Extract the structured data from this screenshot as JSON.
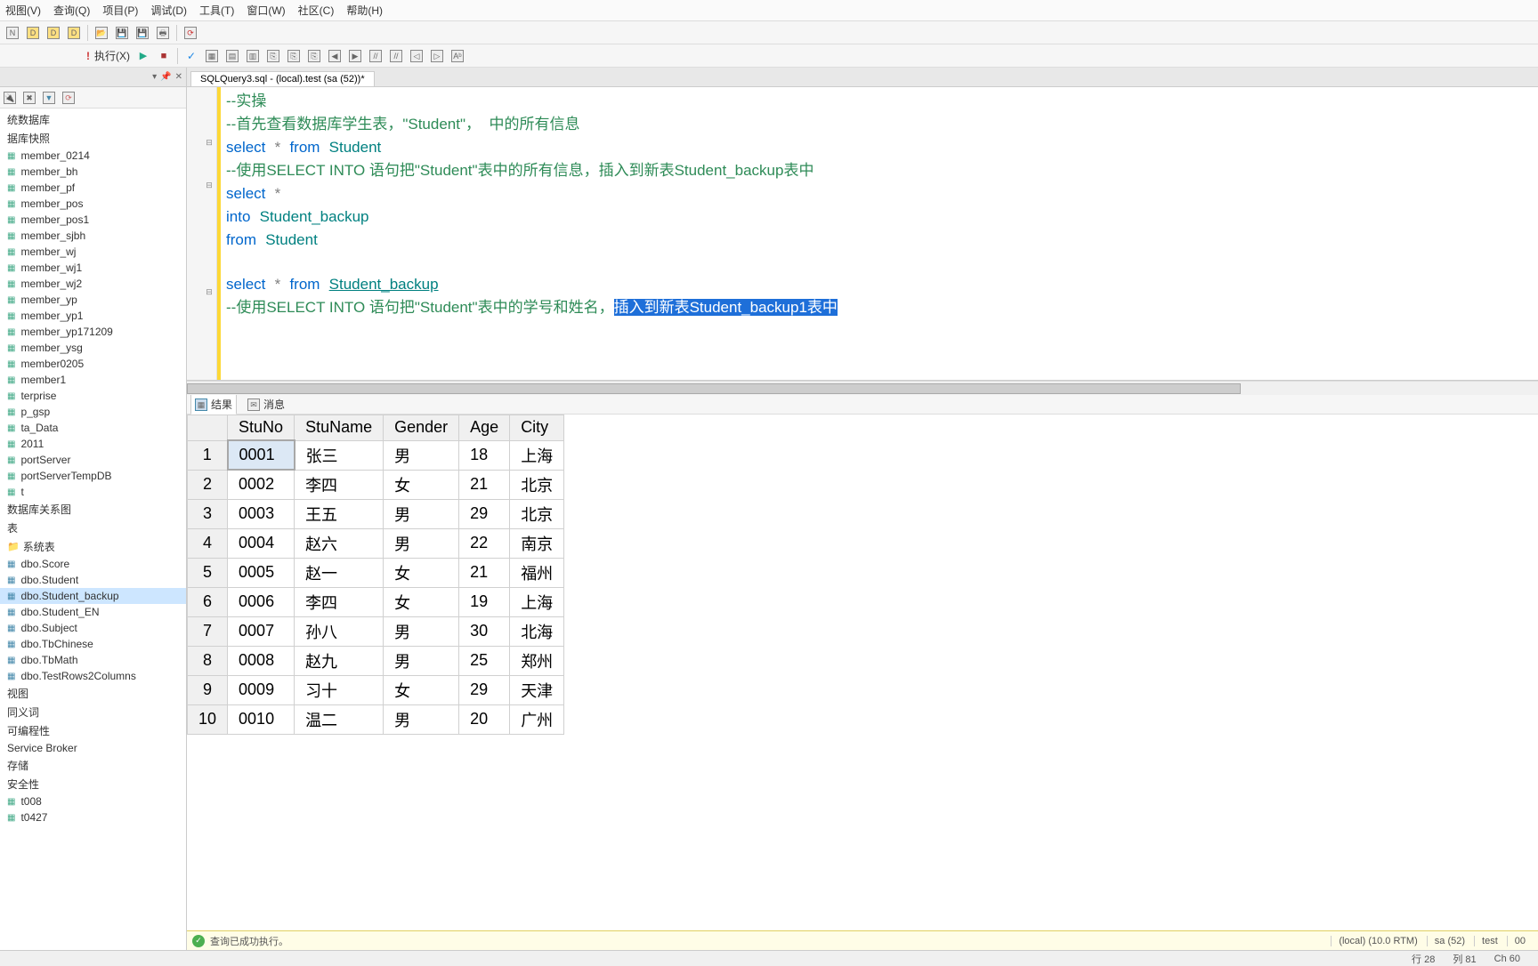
{
  "menu": {
    "items": [
      "视图(V)",
      "查询(Q)",
      "项目(P)",
      "调试(D)",
      "工具(T)",
      "窗口(W)",
      "社区(C)",
      "帮助(H)"
    ]
  },
  "toolbar2": {
    "execute_label": "执行(X)"
  },
  "tab": {
    "title": "SQLQuery3.sql - (local).test (sa (52))*"
  },
  "code": {
    "l1": "--实操",
    "l2": "--首先查看数据库学生表，\"Student\"，  中的所有信息",
    "l3a": "select",
    "l3b": "*",
    "l3c": "from",
    "l3d": "Student",
    "l4": "--使用SELECT INTO 语句把\"Student\"表中的所有信息，插入到新表Student_backup表中",
    "l5a": "select",
    "l5b": "*",
    "l6a": "into",
    "l6b": "Student_backup",
    "l7a": "from",
    "l7b": "Student",
    "l8": "",
    "l9a": "select",
    "l9b": "*",
    "l9c": "from",
    "l9d": "Student_backup",
    "l10_pre": "--使用SELECT INTO 语句把\"Student\"表中的学号和姓名，",
    "l10_sel": "插入到新表Student_backup1表中"
  },
  "tree": {
    "items": [
      {
        "label": "统数据库",
        "cls": "plain"
      },
      {
        "label": "据库快照",
        "cls": "plain"
      },
      {
        "label": "member_0214",
        "cls": "db"
      },
      {
        "label": "member_bh",
        "cls": "db"
      },
      {
        "label": "member_pf",
        "cls": "db"
      },
      {
        "label": "member_pos",
        "cls": "db"
      },
      {
        "label": "member_pos1",
        "cls": "db"
      },
      {
        "label": "member_sjbh",
        "cls": "db"
      },
      {
        "label": "member_wj",
        "cls": "db"
      },
      {
        "label": "member_wj1",
        "cls": "db"
      },
      {
        "label": "member_wj2",
        "cls": "db"
      },
      {
        "label": "member_yp",
        "cls": "db"
      },
      {
        "label": "member_yp1",
        "cls": "db"
      },
      {
        "label": "member_yp171209",
        "cls": "db"
      },
      {
        "label": "member_ysg",
        "cls": "db"
      },
      {
        "label": "member0205",
        "cls": "db"
      },
      {
        "label": "member1",
        "cls": "db"
      },
      {
        "label": "terprise",
        "cls": "db"
      },
      {
        "label": "p_gsp",
        "cls": "db"
      },
      {
        "label": "ta_Data",
        "cls": "db"
      },
      {
        "label": "2011",
        "cls": "db"
      },
      {
        "label": "portServer",
        "cls": "db"
      },
      {
        "label": "portServerTempDB",
        "cls": "db"
      },
      {
        "label": "t",
        "cls": "db"
      },
      {
        "label": "数据库关系图",
        "cls": "plain"
      },
      {
        "label": "表",
        "cls": "plain"
      },
      {
        "label": "系统表",
        "cls": "folder"
      },
      {
        "label": "dbo.Score",
        "cls": "table-icon"
      },
      {
        "label": "dbo.Student",
        "cls": "table-icon"
      },
      {
        "label": "dbo.Student_backup",
        "cls": "table-icon",
        "selected": true
      },
      {
        "label": "dbo.Student_EN",
        "cls": "table-icon"
      },
      {
        "label": "dbo.Subject",
        "cls": "table-icon"
      },
      {
        "label": "dbo.TbChinese",
        "cls": "table-icon"
      },
      {
        "label": "dbo.TbMath",
        "cls": "table-icon"
      },
      {
        "label": "dbo.TestRows2Columns",
        "cls": "table-icon"
      },
      {
        "label": "视图",
        "cls": "plain"
      },
      {
        "label": "同义词",
        "cls": "plain"
      },
      {
        "label": "可编程性",
        "cls": "plain"
      },
      {
        "label": "Service Broker",
        "cls": "plain"
      },
      {
        "label": "存储",
        "cls": "plain"
      },
      {
        "label": "安全性",
        "cls": "plain"
      },
      {
        "label": "t008",
        "cls": "db"
      },
      {
        "label": "t0427",
        "cls": "db"
      }
    ]
  },
  "results": {
    "tab_result": "结果",
    "tab_message": "消息",
    "headers": [
      "StuNo",
      "StuName",
      "Gender",
      "Age",
      "City"
    ],
    "rows": [
      [
        "0001",
        "张三",
        "男",
        "18",
        "上海"
      ],
      [
        "0002",
        "李四",
        "女",
        "21",
        "北京"
      ],
      [
        "0003",
        "王五",
        "男",
        "29",
        "北京"
      ],
      [
        "0004",
        "赵六",
        "男",
        "22",
        "南京"
      ],
      [
        "0005",
        "赵一",
        "女",
        "21",
        "福州"
      ],
      [
        "0006",
        "李四",
        "女",
        "19",
        "上海"
      ],
      [
        "0007",
        "孙八",
        "男",
        "30",
        "北海"
      ],
      [
        "0008",
        "赵九",
        "男",
        "25",
        "郑州"
      ],
      [
        "0009",
        "习十",
        "女",
        "29",
        "天津"
      ],
      [
        "0010",
        "温二",
        "男",
        "20",
        "广州"
      ]
    ]
  },
  "status": {
    "query_ok": "查询已成功执行。",
    "server": "(local) (10.0 RTM)",
    "user": "sa (52)",
    "db": "test",
    "rows": "00",
    "line": "行 28",
    "col": "列 81",
    "ch": "Ch 60"
  }
}
